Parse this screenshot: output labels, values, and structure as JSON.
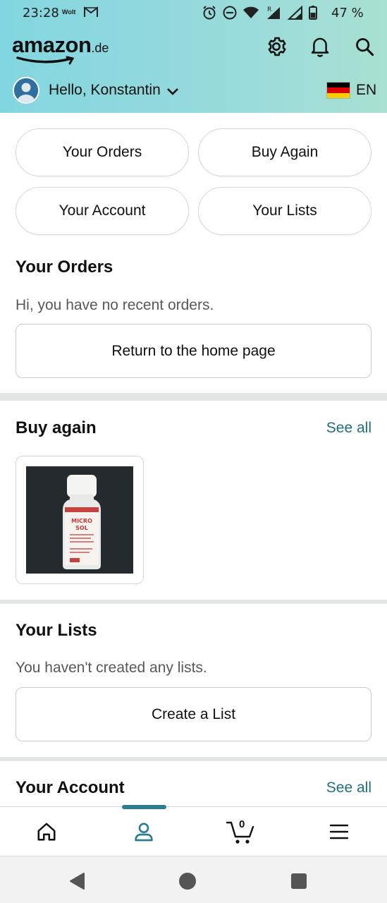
{
  "status_bar": {
    "time": "23:28",
    "carrier": "Wolt",
    "battery_percent": "47 %",
    "signal_badge": "R"
  },
  "header": {
    "logo_word": "amazon",
    "logo_tld": ".de",
    "icons": [
      "gear-icon",
      "bell-icon",
      "search-icon"
    ],
    "greeting": "Hello, Konstantin",
    "language": "EN"
  },
  "quick_buttons": [
    "Your Orders",
    "Buy Again",
    "Your Account",
    "Your Lists"
  ],
  "orders": {
    "title": "Your Orders",
    "message": "Hi, you have no recent orders.",
    "button": "Return to the home page"
  },
  "buy_again": {
    "title": "Buy again",
    "see_all": "See all",
    "product_label_lines": [
      "MICRO",
      "SOL"
    ]
  },
  "lists": {
    "title": "Your Lists",
    "message": "You haven't created any lists.",
    "button": "Create a List"
  },
  "account": {
    "title": "Your Account",
    "see_all": "See all"
  },
  "bottom_nav": {
    "items": [
      "home-icon",
      "account-icon",
      "cart-icon",
      "menu-icon"
    ],
    "cart_count": "0",
    "active": "account"
  },
  "colors": {
    "header_gradient_start": "#82d6df",
    "header_gradient_end": "#a8e0d2",
    "link": "#1f6f7f",
    "active_tab": "#2b7d90"
  }
}
